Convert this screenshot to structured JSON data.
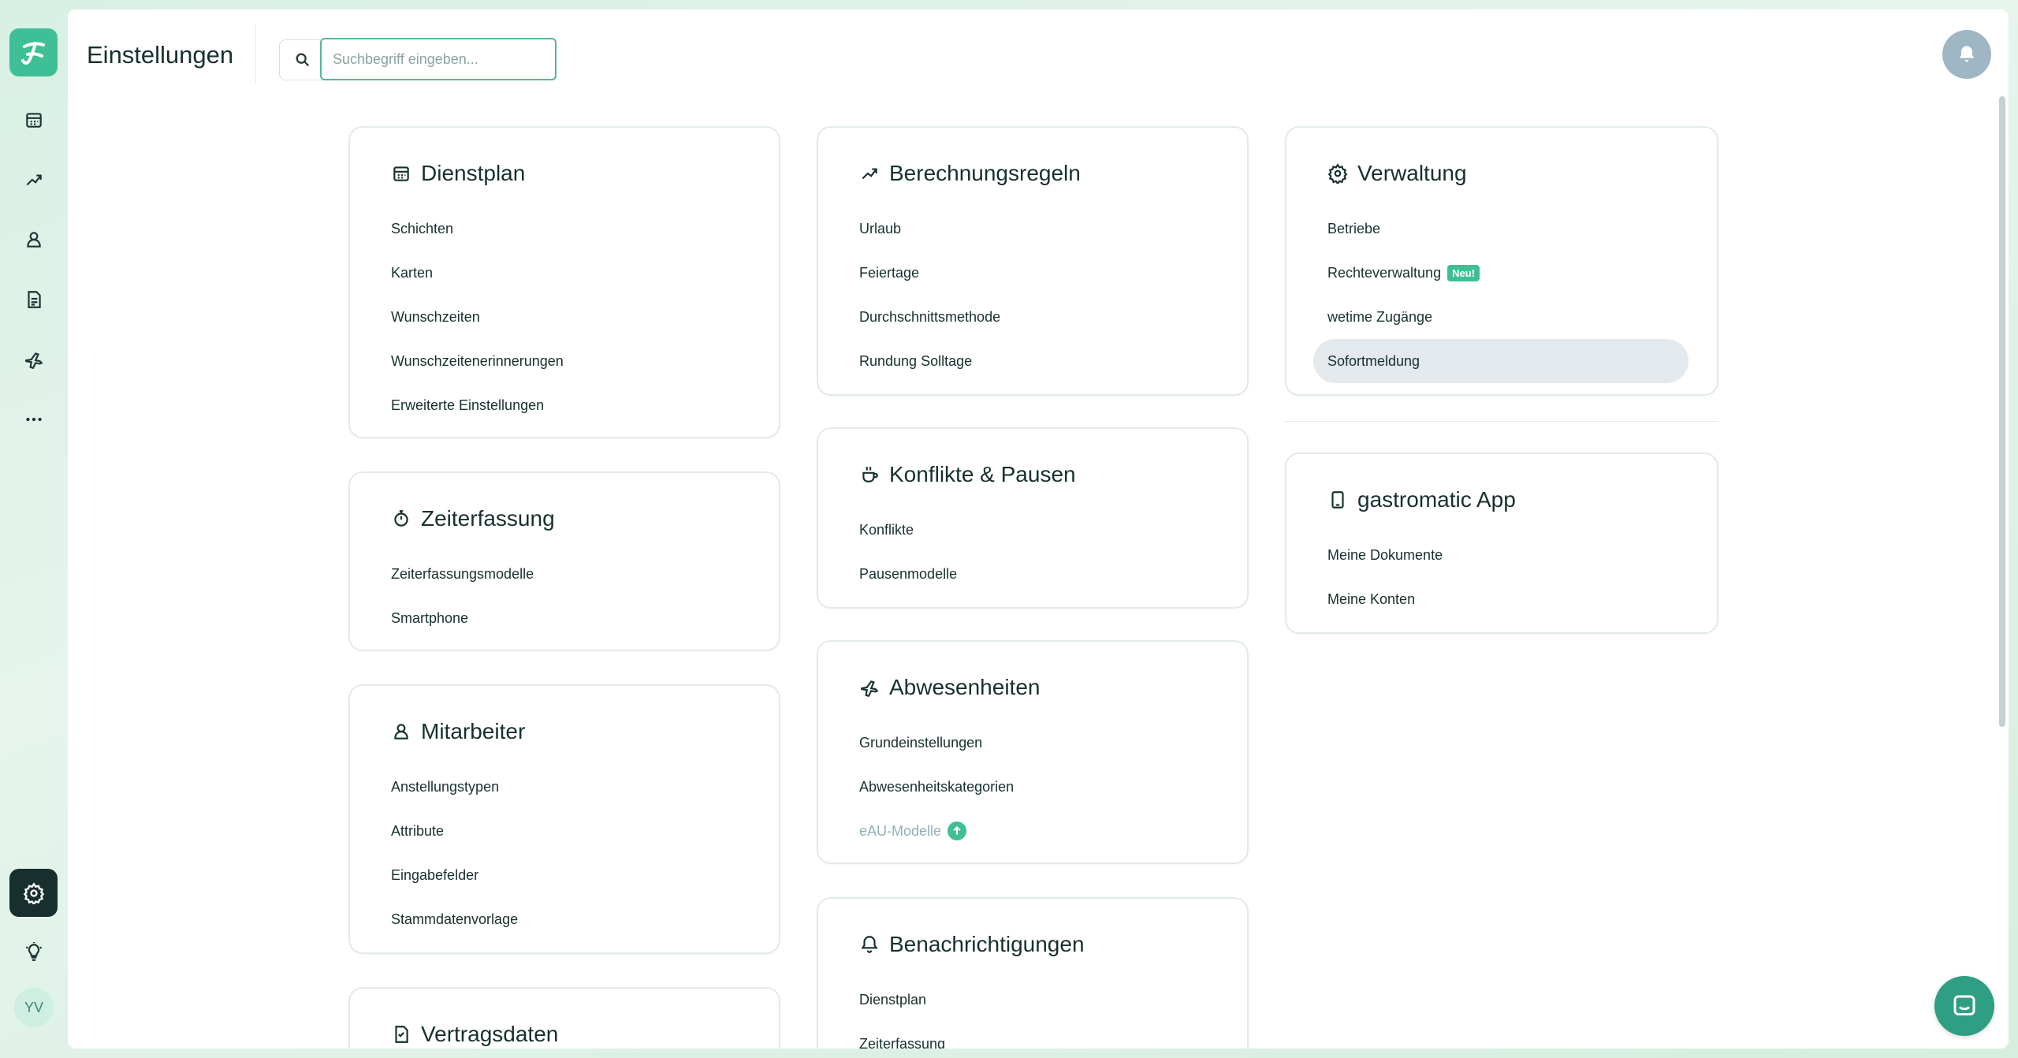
{
  "header": {
    "title": "Einstellungen",
    "search_placeholder": "Suchbegriff eingeben..."
  },
  "sidebar": {
    "avatar_initials": "YV",
    "items": [
      {
        "name": "calendar-icon"
      },
      {
        "name": "trending-up-icon"
      },
      {
        "name": "user-icon"
      },
      {
        "name": "document-icon"
      },
      {
        "name": "plane-icon"
      },
      {
        "name": "more-icon"
      },
      {
        "name": "settings-icon",
        "active": true
      },
      {
        "name": "lightbulb-icon"
      }
    ]
  },
  "colors": {
    "accent": "#3fbf96",
    "dark": "#17302e",
    "selected_bg": "#e4e9ee"
  },
  "cards": {
    "dienstplan": {
      "title": "Dienstplan",
      "icon": "calendar-icon",
      "items": [
        "Schichten",
        "Karten",
        "Wunschzeiten",
        "Wunschzeitenerinnerungen",
        "Erweiterte Einstellungen"
      ]
    },
    "zeiterfassung": {
      "title": "Zeiterfassung",
      "icon": "stopwatch-icon",
      "items": [
        "Zeiterfassungsmodelle",
        "Smartphone"
      ]
    },
    "mitarbeiter": {
      "title": "Mitarbeiter",
      "icon": "user-icon",
      "items": [
        "Anstellungstypen",
        "Attribute",
        "Eingabefelder",
        "Stammdatenvorlage"
      ]
    },
    "vertragsdaten": {
      "title": "Vertragsdaten",
      "icon": "contract-icon"
    },
    "berechnungsregeln": {
      "title": "Berechnungsregeln",
      "icon": "trending-up-icon",
      "items": [
        "Urlaub",
        "Feiertage",
        "Durchschnittsmethode",
        "Rundung Solltage"
      ]
    },
    "konflikte": {
      "title": "Konflikte & Pausen",
      "icon": "coffee-icon",
      "items": [
        "Konflikte",
        "Pausenmodelle"
      ]
    },
    "abwesenheiten": {
      "title": "Abwesenheiten",
      "icon": "plane-icon",
      "items": [
        "Grundeinstellungen",
        "Abwesenheitskategorien"
      ],
      "upgrade_item": "eAU-Modelle"
    },
    "benachrichtigungen": {
      "title": "Benachrichtigungen",
      "icon": "bell-icon",
      "items": [
        "Dienstplan",
        "Zeiterfassung"
      ]
    },
    "verwaltung": {
      "title": "Verwaltung",
      "icon": "gear-icon",
      "items": [
        "Betriebe",
        "Rechteverwaltung",
        "wetime Zugänge",
        "Sofortmeldung"
      ],
      "new_badge": "Neu!",
      "selected_item": "Sofortmeldung"
    },
    "app": {
      "title": "gastromatic App",
      "icon": "smartphone-icon",
      "items": [
        "Meine Dokumente",
        "Meine Konten"
      ]
    }
  }
}
